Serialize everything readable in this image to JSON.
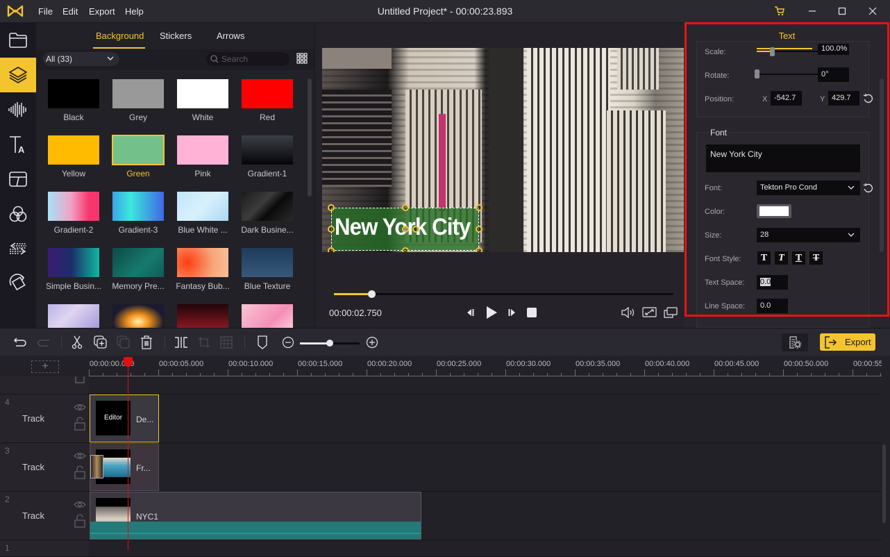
{
  "app": {
    "title": "Untitled Project* - 00:00:23.893",
    "menu": [
      "File",
      "Edit",
      "Export",
      "Help"
    ],
    "accent_color": "#f4c42e"
  },
  "rail": {
    "items": [
      {
        "name": "media",
        "icon": "folder-icon"
      },
      {
        "name": "elements",
        "icon": "layers-icon",
        "active": true
      },
      {
        "name": "audio",
        "icon": "audio-wave-icon"
      },
      {
        "name": "text",
        "icon": "text-icon"
      },
      {
        "name": "transitions",
        "icon": "transition-icon"
      },
      {
        "name": "filters",
        "icon": "filters-icon"
      },
      {
        "name": "overlays",
        "icon": "arrows-icon"
      },
      {
        "name": "animation",
        "icon": "rotate-square-icon"
      }
    ]
  },
  "media": {
    "tabs": [
      "Background",
      "Stickers",
      "Arrows"
    ],
    "active_tab": "Background",
    "filter": "All (33)",
    "search_placeholder": "Search",
    "items": [
      {
        "label": "Black",
        "color": "#000000"
      },
      {
        "label": "Grey",
        "color": "#999999"
      },
      {
        "label": "White",
        "color": "#ffffff"
      },
      {
        "label": "Red",
        "color": "#ff0000"
      },
      {
        "label": "Yellow",
        "color": "#ffbb00"
      },
      {
        "label": "Green",
        "color": "#74c08a",
        "selected": true
      },
      {
        "label": "Pink",
        "color": "#ffb1d6"
      },
      {
        "label": "Gradient-1",
        "color": "linear-gradient(180deg,#3b3f47,#050506)"
      },
      {
        "label": "Gradient-2",
        "color": "linear-gradient(90deg,#a6e3f7,#f2a2c6 45%,#f7366e 80%)"
      },
      {
        "label": "Gradient-3",
        "color": "linear-gradient(90deg,#3aa3e8,#3ce8dc 35%,#3f68e6 100%)"
      },
      {
        "label": "Blue White ...",
        "color": "linear-gradient(135deg,#bfe6fb,#d9f0fc 50%,#a8d9f5)"
      },
      {
        "label": "Dark Busine...",
        "color": "linear-gradient(135deg,#1a1a1a,#3c3c3c 40%,#0a0a0a 60%,#2a2a2a)"
      },
      {
        "label": "Simple Busin...",
        "color": "linear-gradient(90deg,#3b1c72,#1b2d6a 45%,#11b7a0)"
      },
      {
        "label": "Memory Pre...",
        "color": "linear-gradient(135deg,#0d4a47,#167a6d 60%,#0f5c58)"
      },
      {
        "label": "Fantasy Bub...",
        "color": "radial-gradient(circle at 20% 50%,#ff3c12,#f6a77a 60%,#fbbf97)"
      },
      {
        "label": "Blue Texture",
        "color": "linear-gradient(180deg,#1f3b5a,#36597a)"
      },
      {
        "label": "",
        "color": "linear-gradient(135deg,#b8b4e8,#e0d4f0 40%,#9c94d8)"
      },
      {
        "label": "",
        "color": "radial-gradient(ellipse at 50% 60%,#fff1b0,#f0901a 30%,#1a1a30 70%)"
      },
      {
        "label": "",
        "color": "linear-gradient(180deg,#200508,#7a1420 70%,#a01a28)"
      },
      {
        "label": "",
        "color": "linear-gradient(135deg,#f9c6d3,#f48fb6 60%,#fbd2df)"
      }
    ]
  },
  "preview": {
    "overlay_text": "New York City",
    "timecode": "00:00:02.750",
    "progress": 0.11
  },
  "properties": {
    "tab": "Text",
    "transform": {
      "scale_label": "Scale:",
      "scale_value": "100.0%",
      "rotate_label": "Rotate:",
      "rotate_value": "0°",
      "position_label": "Position:",
      "x_label": "X",
      "x_value": "-542.7",
      "y_label": "Y",
      "y_value": "429.7"
    },
    "font": {
      "title": "Font",
      "text_value": "New York City",
      "font_label": "Font:",
      "font_value": "Tekton Pro Cond",
      "color_label": "Color:",
      "color_value": "#ffffff",
      "size_label": "Size:",
      "size_value": "28",
      "style_label": "Font Style:",
      "styles": [
        "bold",
        "italic",
        "underline",
        "strikethrough"
      ],
      "text_space_label": "Text Space:",
      "text_space_value": "0.0",
      "line_space_label": "Line Space:",
      "line_space_value": "0.0"
    }
  },
  "timeline": {
    "toolbar": {
      "export_label": "Export",
      "zoom_level": 0.5
    },
    "ruler": [
      "00:00:00.000",
      "00:00:05.000",
      "00:00:10.000",
      "00:00:15.000",
      "00:00:20.000",
      "00:00:25.000",
      "00:00:30.000",
      "00:00:35.000",
      "00:00:40.000",
      "00:00:45.000",
      "00:00:50.000",
      "00:00:55"
    ],
    "tracks": [
      {
        "number": "4",
        "name": "Track",
        "clip": {
          "thumb_text": "Editor",
          "name": "De..."
        }
      },
      {
        "number": "3",
        "name": "Track",
        "clip": {
          "name": "Fr..."
        }
      },
      {
        "number": "2",
        "name": "Track",
        "clip": {
          "name": "NYC1"
        }
      },
      {
        "number": "1",
        "name": ""
      }
    ]
  }
}
